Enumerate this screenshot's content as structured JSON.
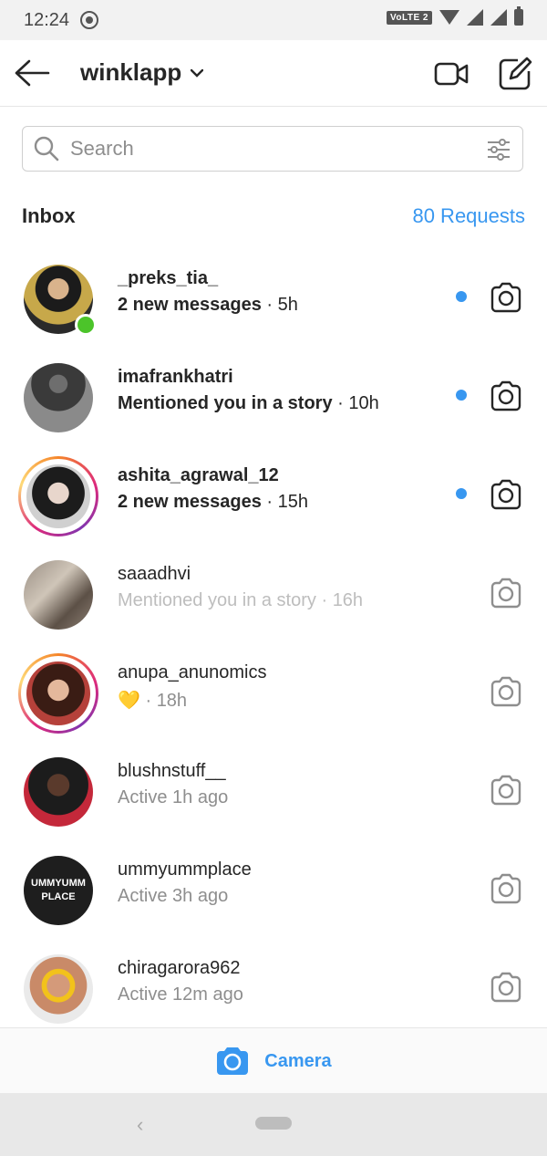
{
  "status_bar": {
    "time": "12:24",
    "network_badge": "VoLTE 2"
  },
  "header": {
    "title": "winklapp",
    "icons": [
      "back-arrow-icon",
      "chevron-down-icon",
      "video-camera-icon",
      "compose-icon"
    ]
  },
  "search": {
    "placeholder": "Search"
  },
  "inbox": {
    "label": "Inbox",
    "requests": "80 Requests"
  },
  "threads": [
    {
      "username": "_preks_tia_",
      "status": "2 new messages",
      "time": "5h",
      "unread": true,
      "online": true,
      "story_ring": false
    },
    {
      "username": "imafrankhatri",
      "status": "Mentioned you in a story",
      "time": "10h",
      "unread": true,
      "online": false,
      "story_ring": false
    },
    {
      "username": "ashita_agrawal_12",
      "status": "2 new messages",
      "time": "15h",
      "unread": true,
      "online": false,
      "story_ring": true
    },
    {
      "username": "saaadhvi",
      "status": "Mentioned you in a story",
      "time": "16h",
      "unread": false,
      "online": false,
      "story_ring": false
    },
    {
      "username": "anupa_anunomics",
      "status": "💛",
      "time": "18h",
      "unread": false,
      "online": false,
      "story_ring": true
    },
    {
      "username": "blushnstuff__",
      "status": "Active 1h ago",
      "time": "",
      "unread": false,
      "online": false,
      "story_ring": false
    },
    {
      "username": "ummyummplace",
      "status": "Active 3h ago",
      "time": "",
      "unread": false,
      "online": false,
      "story_ring": false,
      "avatar_text": "UMMYUMM PLACE"
    },
    {
      "username": "chiragarora962",
      "status": "Active 12m ago",
      "time": "",
      "unread": false,
      "online": false,
      "story_ring": false
    }
  ],
  "bottom_bar": {
    "camera_label": "Camera"
  },
  "colors": {
    "accent": "#3897f0",
    "online": "#4cc42a"
  }
}
